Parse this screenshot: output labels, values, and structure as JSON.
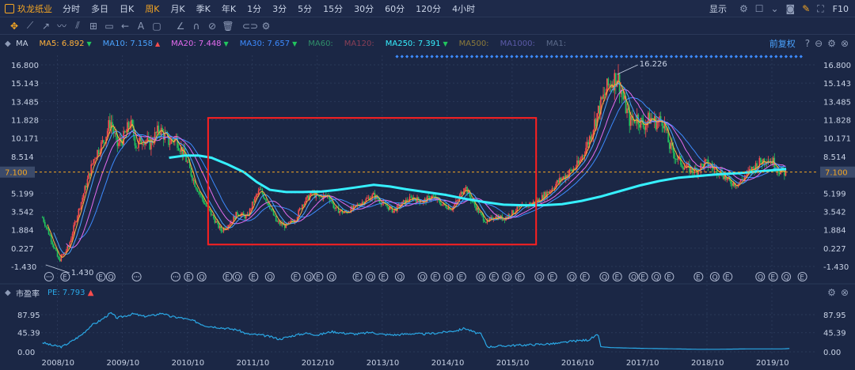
{
  "top_bar": {
    "stock_name": "玖龙纸业",
    "periods": [
      "分时",
      "多日",
      "日K",
      "周K",
      "月K",
      "季K",
      "年K",
      "1分",
      "3分",
      "5分",
      "15分",
      "30分",
      "60分",
      "120分",
      "4小时"
    ],
    "active_period": "周K",
    "display_label": "显示",
    "f10_label": "F10"
  },
  "ma_bar": {
    "label": "MA",
    "items": [
      {
        "text": "MA5: 6.892",
        "color": "#ffb13b",
        "arrow": "▼"
      },
      {
        "text": "MA10: 7.158",
        "color": "#4aa3ff",
        "arrow": "▲"
      },
      {
        "text": "MA20: 7.448",
        "color": "#e56cf0",
        "arrow": "▼"
      },
      {
        "text": "MA30: 7.657",
        "color": "#3d8bff",
        "arrow": "▼"
      },
      {
        "text": "MA60:",
        "color": "#2f8f6a",
        "arrow": ""
      },
      {
        "text": "MA120:",
        "color": "#8a3f56",
        "arrow": ""
      },
      {
        "text": "MA250: 7.391",
        "color": "#36f0ff",
        "arrow": "▼"
      },
      {
        "text": "MA500:",
        "color": "#8c7a3a",
        "arrow": ""
      },
      {
        "text": "MA1000:",
        "color": "#5b5aa8",
        "arrow": ""
      },
      {
        "text": "MA1:",
        "color": "#5b6a8a",
        "arrow": ""
      }
    ],
    "restore_label": "前复权"
  },
  "pe_bar": {
    "label": "市盈率",
    "value_text": "PE: 7.793",
    "arrow": "▲"
  },
  "colors": {
    "background": "#1b2745",
    "grid": "#2a3858",
    "up": "#ff4d4d",
    "down": "#22c55e",
    "ma5": "#ffb13b",
    "ma10": "#4aa3ff",
    "ma20": "#e56cf0",
    "ma30": "#3d8bff",
    "ma250": "#36f0ff",
    "pe": "#2aa8e6",
    "highlight_box": "#ff2020",
    "current_price": "#f5a623"
  },
  "chart_data": [
    {
      "type": "line",
      "subtype": "candlestick",
      "title": "玖龙纸业",
      "y_ticks": [
        16.8,
        15.143,
        13.485,
        11.828,
        10.171,
        8.514,
        5.199,
        3.542,
        1.884,
        0.227,
        -1.43
      ],
      "y_tick_labels": [
        "16.800",
        "15.143",
        "13.485",
        "11.828",
        "10.171",
        "8.514",
        "5.199",
        "3.542",
        "1.884",
        "0.227",
        "-1.430"
      ],
      "ylim": [
        -1.43,
        16.8
      ],
      "current_price": 7.1,
      "current_price_label": "7.100",
      "max_annotation": {
        "x": 2017.45,
        "y": 16.226,
        "label": "16.226"
      },
      "min_annotation": {
        "x": 2008.65,
        "y": -1.43,
        "label": "1.430"
      },
      "x_ticks": [
        "2008/10",
        "2009/10",
        "2010/10",
        "2011/10",
        "2012/10",
        "2013/10",
        "2014/10",
        "2015/10",
        "2016/10",
        "2017/10",
        "2018/10",
        "2019/10"
      ],
      "xlim": [
        2008.58,
        2020.5
      ],
      "price_path": [
        [
          2008.6,
          3.0
        ],
        [
          2008.75,
          0.8
        ],
        [
          2008.85,
          -0.9
        ],
        [
          2009.0,
          0.3
        ],
        [
          2009.1,
          2.5
        ],
        [
          2009.25,
          5.5
        ],
        [
          2009.4,
          8.5
        ],
        [
          2009.55,
          10.0
        ],
        [
          2009.65,
          11.8
        ],
        [
          2009.75,
          9.5
        ],
        [
          2009.85,
          10.2
        ],
        [
          2009.95,
          11.6
        ],
        [
          2010.05,
          9.4
        ],
        [
          2010.15,
          10.2
        ],
        [
          2010.25,
          9.6
        ],
        [
          2010.4,
          11.0
        ],
        [
          2010.55,
          9.8
        ],
        [
          2010.65,
          10.2
        ],
        [
          2010.8,
          8.4
        ],
        [
          2010.95,
          6.0
        ],
        [
          2011.1,
          4.2
        ],
        [
          2011.25,
          2.8
        ],
        [
          2011.35,
          1.8
        ],
        [
          2011.5,
          2.6
        ],
        [
          2011.6,
          3.4
        ],
        [
          2011.75,
          3.0
        ],
        [
          2011.85,
          4.5
        ],
        [
          2011.95,
          5.5
        ],
        [
          2012.1,
          4.0
        ],
        [
          2012.2,
          2.6
        ],
        [
          2012.35,
          2.2
        ],
        [
          2012.5,
          2.9
        ],
        [
          2012.6,
          4.2
        ],
        [
          2012.75,
          5.2
        ],
        [
          2012.85,
          4.8
        ],
        [
          2013.0,
          5.0
        ],
        [
          2013.1,
          3.8
        ],
        [
          2013.25,
          3.4
        ],
        [
          2013.4,
          3.9
        ],
        [
          2013.55,
          4.5
        ],
        [
          2013.7,
          5.0
        ],
        [
          2013.85,
          4.2
        ],
        [
          2014.0,
          3.6
        ],
        [
          2014.15,
          4.3
        ],
        [
          2014.3,
          4.8
        ],
        [
          2014.45,
          4.4
        ],
        [
          2014.6,
          4.9
        ],
        [
          2014.75,
          4.2
        ],
        [
          2014.9,
          3.8
        ],
        [
          2015.0,
          4.6
        ],
        [
          2015.1,
          5.9
        ],
        [
          2015.2,
          4.6
        ],
        [
          2015.35,
          3.2
        ],
        [
          2015.45,
          2.5
        ],
        [
          2015.55,
          3.1
        ],
        [
          2015.7,
          2.9
        ],
        [
          2015.85,
          3.5
        ],
        [
          2015.95,
          3.9
        ],
        [
          2016.1,
          4.2
        ],
        [
          2016.25,
          4.6
        ],
        [
          2016.4,
          5.4
        ],
        [
          2016.55,
          6.3
        ],
        [
          2016.7,
          7.0
        ],
        [
          2016.85,
          7.8
        ],
        [
          2017.0,
          9.8
        ],
        [
          2017.15,
          12.5
        ],
        [
          2017.3,
          14.8
        ],
        [
          2017.45,
          15.8
        ],
        [
          2017.55,
          13.5
        ],
        [
          2017.65,
          11.6
        ],
        [
          2017.75,
          12.1
        ],
        [
          2017.85,
          11.3
        ],
        [
          2017.95,
          12.0
        ],
        [
          2018.05,
          11.6
        ],
        [
          2018.15,
          11.9
        ],
        [
          2018.25,
          9.5
        ],
        [
          2018.35,
          8.5
        ],
        [
          2018.5,
          7.5
        ],
        [
          2018.65,
          7.2
        ],
        [
          2018.8,
          7.9
        ],
        [
          2018.95,
          7.4
        ],
        [
          2019.05,
          7.1
        ],
        [
          2019.15,
          6.3
        ],
        [
          2019.3,
          6.0
        ],
        [
          2019.45,
          6.9
        ],
        [
          2019.6,
          7.8
        ],
        [
          2019.75,
          8.4
        ],
        [
          2019.85,
          8.0
        ],
        [
          2019.95,
          7.2
        ],
        [
          2020.05,
          7.0
        ]
      ],
      "ma250_path": [
        [
          2010.55,
          8.4
        ],
        [
          2010.8,
          8.6
        ],
        [
          2011.0,
          8.6
        ],
        [
          2011.2,
          8.4
        ],
        [
          2011.45,
          7.8
        ],
        [
          2011.7,
          7.1
        ],
        [
          2011.9,
          6.2
        ],
        [
          2012.1,
          5.5
        ],
        [
          2012.35,
          5.3
        ],
        [
          2012.6,
          5.3
        ],
        [
          2012.9,
          5.35
        ],
        [
          2013.15,
          5.5
        ],
        [
          2013.4,
          5.7
        ],
        [
          2013.7,
          5.95
        ],
        [
          2013.95,
          5.8
        ],
        [
          2014.2,
          5.55
        ],
        [
          2014.5,
          5.3
        ],
        [
          2014.8,
          5.05
        ],
        [
          2015.1,
          4.7
        ],
        [
          2015.4,
          4.4
        ],
        [
          2015.7,
          4.15
        ],
        [
          2016.0,
          4.1
        ],
        [
          2016.3,
          4.1
        ],
        [
          2016.6,
          4.2
        ],
        [
          2016.9,
          4.5
        ],
        [
          2017.2,
          4.9
        ],
        [
          2017.5,
          5.4
        ],
        [
          2017.8,
          5.9
        ],
        [
          2018.1,
          6.3
        ],
        [
          2018.4,
          6.6
        ],
        [
          2018.7,
          6.75
        ],
        [
          2019.0,
          6.9
        ],
        [
          2019.3,
          7.0
        ],
        [
          2019.6,
          7.15
        ],
        [
          2019.9,
          7.3
        ],
        [
          2020.05,
          7.39
        ]
      ],
      "highlight_box": {
        "x_from": 2011.15,
        "x_to": 2016.2,
        "y_from": 0.55,
        "y_to": 12.0
      },
      "event_markers": [
        {
          "x": 2008.7,
          "kind": "ellipsis"
        },
        {
          "x": 2008.95,
          "kind": "E"
        },
        {
          "x": 2009.5,
          "kind": "E"
        },
        {
          "x": 2009.65,
          "kind": "Q"
        },
        {
          "x": 2010.05,
          "kind": "ellipsis"
        },
        {
          "x": 2010.65,
          "kind": "ellipsis"
        },
        {
          "x": 2010.85,
          "kind": "E"
        },
        {
          "x": 2011.05,
          "kind": "Q"
        },
        {
          "x": 2011.45,
          "kind": "E"
        },
        {
          "x": 2011.6,
          "kind": "Q"
        },
        {
          "x": 2011.85,
          "kind": "E"
        },
        {
          "x": 2012.1,
          "kind": "Q"
        },
        {
          "x": 2012.5,
          "kind": "E"
        },
        {
          "x": 2012.7,
          "kind": "Q"
        },
        {
          "x": 2012.85,
          "kind": "E"
        },
        {
          "x": 2013.05,
          "kind": "Q"
        },
        {
          "x": 2013.45,
          "kind": "E"
        },
        {
          "x": 2013.65,
          "kind": "Q"
        },
        {
          "x": 2013.85,
          "kind": "E"
        },
        {
          "x": 2014.1,
          "kind": "Q"
        },
        {
          "x": 2014.45,
          "kind": "Q"
        },
        {
          "x": 2014.65,
          "kind": "E"
        },
        {
          "x": 2014.85,
          "kind": "Q"
        },
        {
          "x": 2015.05,
          "kind": "E"
        },
        {
          "x": 2015.35,
          "kind": "Q"
        },
        {
          "x": 2015.55,
          "kind": "E"
        },
        {
          "x": 2015.75,
          "kind": "Q"
        },
        {
          "x": 2015.95,
          "kind": "E"
        },
        {
          "x": 2016.25,
          "kind": "Q"
        },
        {
          "x": 2016.45,
          "kind": "E"
        },
        {
          "x": 2016.75,
          "kind": "Q"
        },
        {
          "x": 2016.95,
          "kind": "E"
        },
        {
          "x": 2017.25,
          "kind": "Q"
        },
        {
          "x": 2017.45,
          "kind": "E"
        },
        {
          "x": 2017.7,
          "kind": "Q"
        },
        {
          "x": 2017.85,
          "kind": "E"
        },
        {
          "x": 2018.05,
          "kind": "Q"
        },
        {
          "x": 2018.25,
          "kind": "E"
        },
        {
          "x": 2018.7,
          "kind": "E"
        },
        {
          "x": 2018.95,
          "kind": "Q"
        },
        {
          "x": 2019.15,
          "kind": "E"
        },
        {
          "x": 2019.65,
          "kind": "Q"
        },
        {
          "x": 2019.85,
          "kind": "E"
        },
        {
          "x": 2020.05,
          "kind": "Q"
        },
        {
          "x": 2020.3,
          "kind": "E"
        }
      ]
    },
    {
      "type": "line",
      "title": "市盈率",
      "y_ticks": [
        87.95,
        45.39,
        0.0
      ],
      "y_tick_labels": [
        "87.95",
        "45.39",
        "0.00"
      ],
      "ylim": [
        0,
        100
      ],
      "series": [
        {
          "name": "PE",
          "points": [
            [
              2008.6,
              22
            ],
            [
              2008.75,
              15
            ],
            [
              2008.9,
              12
            ],
            [
              2009.05,
              25
            ],
            [
              2009.2,
              40
            ],
            [
              2009.35,
              62
            ],
            [
              2009.5,
              75
            ],
            [
              2009.65,
              92
            ],
            [
              2009.75,
              80
            ],
            [
              2009.9,
              86
            ],
            [
              2010.0,
              90
            ],
            [
              2010.15,
              84
            ],
            [
              2010.3,
              86
            ],
            [
              2010.45,
              92
            ],
            [
              2010.55,
              84
            ],
            [
              2010.75,
              80
            ],
            [
              2010.95,
              72
            ],
            [
              2011.1,
              62
            ],
            [
              2011.3,
              58
            ],
            [
              2011.45,
              55
            ],
            [
              2011.6,
              52
            ],
            [
              2011.75,
              42
            ],
            [
              2011.95,
              40
            ],
            [
              2012.1,
              36
            ],
            [
              2012.25,
              30
            ],
            [
              2012.45,
              38
            ],
            [
              2012.65,
              44
            ],
            [
              2012.85,
              40
            ],
            [
              2013.05,
              48
            ],
            [
              2013.25,
              44
            ],
            [
              2013.45,
              42
            ],
            [
              2013.65,
              46
            ],
            [
              2013.85,
              41
            ],
            [
              2014.05,
              40
            ],
            [
              2014.25,
              43
            ],
            [
              2014.45,
              42
            ],
            [
              2014.65,
              44
            ],
            [
              2014.85,
              48
            ],
            [
              2015.0,
              51
            ],
            [
              2015.1,
              56
            ],
            [
              2015.25,
              46
            ],
            [
              2015.35,
              42
            ],
            [
              2015.45,
              12
            ],
            [
              2015.6,
              13
            ],
            [
              2015.8,
              15
            ],
            [
              2016.0,
              16
            ],
            [
              2016.3,
              18
            ],
            [
              2016.55,
              20
            ],
            [
              2016.75,
              25
            ],
            [
              2017.0,
              28
            ],
            [
              2017.15,
              40
            ],
            [
              2017.2,
              12
            ],
            [
              2017.35,
              10
            ],
            [
              2017.6,
              9
            ],
            [
              2017.9,
              8
            ],
            [
              2018.3,
              7
            ],
            [
              2018.7,
              6
            ],
            [
              2019.0,
              6
            ],
            [
              2019.5,
              7
            ],
            [
              2020.0,
              7
            ],
            [
              2020.1,
              7.793
            ]
          ]
        }
      ]
    }
  ]
}
